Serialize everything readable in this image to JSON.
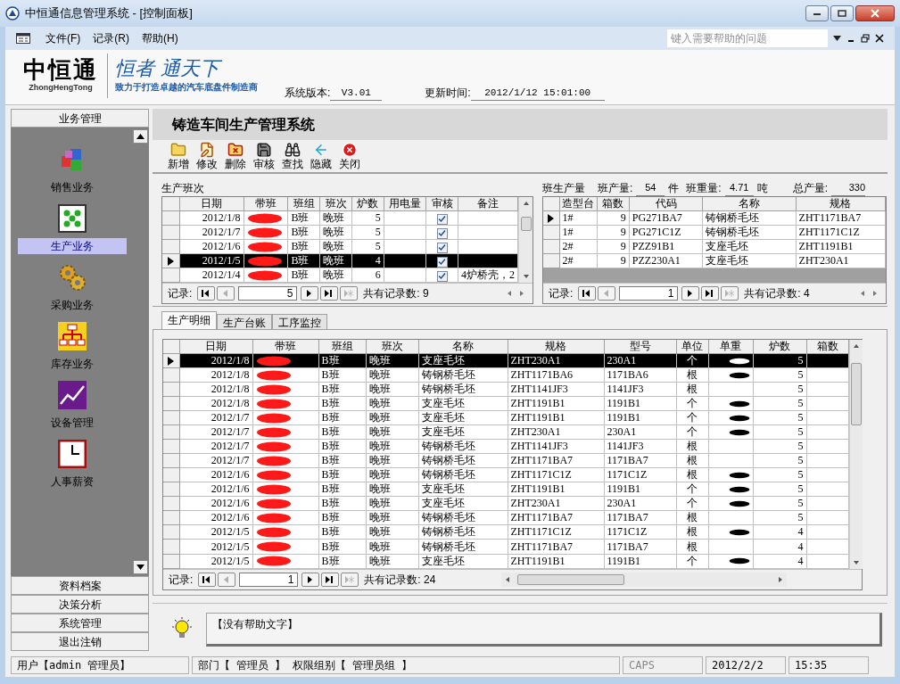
{
  "window": {
    "title": "中恒通信息管理系统 - [控制面板]"
  },
  "menu": [
    "文件(F)",
    "记录(R)",
    "帮助(H)"
  ],
  "help_search": {
    "placeholder": "键入需要帮助的问题"
  },
  "header": {
    "logo": "中恒通",
    "logo_sub": "ZhongHengTong",
    "slogan": "恒者 通天下",
    "tagline": "致力于打造卓越的汽车底盘件制造商",
    "version_label": "系统版本:",
    "version": "V3.01",
    "update_label": "更新时间:",
    "update_time": "2012/1/12 15:01:00"
  },
  "sidebar": {
    "header": "业务管理",
    "items": [
      {
        "label": "销售业务",
        "selected": false
      },
      {
        "label": "生产业务",
        "selected": true
      },
      {
        "label": "采购业务",
        "selected": false
      },
      {
        "label": "库存业务",
        "selected": false
      },
      {
        "label": "设备管理",
        "selected": false
      },
      {
        "label": "人事薪资",
        "selected": false
      }
    ],
    "buttons": [
      "资料档案",
      "决策分析",
      "系统管理",
      "退出注销"
    ]
  },
  "content": {
    "title": "铸造车间生产管理系统",
    "toolbar": [
      "新增",
      "修改",
      "删除",
      "审核",
      "查找",
      "隐藏",
      "关闭"
    ]
  },
  "shift_grid": {
    "title": "生产班次",
    "columns": [
      "日期",
      "带班",
      "班组",
      "班次",
      "炉数",
      "用电量",
      "审核",
      "备注"
    ],
    "rows": [
      {
        "date": "2012/1/8",
        "redacted": true,
        "group": "B班",
        "shift": "晚班",
        "furnaces": "5",
        "approved": true,
        "note": "",
        "current": false,
        "selected": false
      },
      {
        "date": "2012/1/7",
        "redacted": true,
        "group": "B班",
        "shift": "晚班",
        "furnaces": "5",
        "approved": true,
        "note": "",
        "current": false,
        "selected": false
      },
      {
        "date": "2012/1/6",
        "redacted": true,
        "group": "B班",
        "shift": "晚班",
        "furnaces": "5",
        "approved": true,
        "note": "",
        "current": false,
        "selected": false
      },
      {
        "date": "2012/1/5",
        "redacted": true,
        "group": "B班",
        "shift": "晚班",
        "furnaces": "4",
        "approved": true,
        "note": "",
        "current": true,
        "selected": true
      },
      {
        "date": "2012/1/4",
        "redacted": true,
        "group": "B班",
        "shift": "晚班",
        "furnaces": "6",
        "approved": true,
        "note": "4炉桥壳，2",
        "current": false,
        "selected": false
      }
    ],
    "nav": {
      "label": "记录:",
      "current": "5",
      "count": "共有记录数: 9"
    }
  },
  "output": {
    "title": "班生产量",
    "qty_label": "班产量:",
    "qty": "54",
    "qty_unit": "件",
    "weight_label": "班重量:",
    "weight": "4.71",
    "weight_unit": "吨",
    "total_label": "总产量:",
    "total": "330",
    "columns": [
      "造型台",
      "箱数",
      "代码",
      "名称",
      "规格"
    ],
    "rows": [
      {
        "cells": [
          "1#",
          "9",
          "PG271BA7",
          "铸钢桥毛坯",
          "ZHT1171BA7"
        ],
        "current": true
      },
      {
        "cells": [
          "1#",
          "9",
          "PG271C1Z",
          "铸钢桥毛坯",
          "ZHT1171C1Z"
        ],
        "current": false
      },
      {
        "cells": [
          "2#",
          "9",
          "PZZ91B1",
          "支座毛坯",
          "ZHT1191B1"
        ],
        "current": false
      },
      {
        "cells": [
          "2#",
          "9",
          "PZZ230A1",
          "支座毛坯",
          "ZHT230A1"
        ],
        "current": false
      }
    ],
    "nav": {
      "label": "记录:",
      "current": "1",
      "count": "共有记录数: 4"
    }
  },
  "tabs": [
    {
      "label": "生产明细",
      "selected": true
    },
    {
      "label": "生产台账",
      "selected": false
    },
    {
      "label": "工序监控",
      "selected": false
    }
  ],
  "detail_grid": {
    "columns": [
      "日期",
      "带班",
      "班组",
      "班次",
      "名称",
      "规格",
      "型号",
      "单位",
      "单重",
      "炉数",
      "箱数"
    ],
    "rows": [
      {
        "date": "2012/1/8",
        "group": "B班",
        "shift": "晚班",
        "name": "支座毛坯",
        "spec": "ZHT230A1",
        "model": "230A1",
        "unit": "个",
        "weight_redacted": true,
        "furnaces": "5",
        "selected": true
      },
      {
        "date": "2012/1/8",
        "group": "B班",
        "shift": "晚班",
        "name": "铸钢桥毛坯",
        "spec": "ZHT1171BA6",
        "model": "1171BA6",
        "unit": "根",
        "weight_redacted": true,
        "furnaces": "5",
        "selected": false
      },
      {
        "date": "2012/1/8",
        "group": "B班",
        "shift": "晚班",
        "name": "铸钢桥毛坯",
        "spec": "ZHT1141JF3",
        "model": "1141JF3",
        "unit": "根",
        "weight_redacted": false,
        "furnaces": "5",
        "selected": false
      },
      {
        "date": "2012/1/8",
        "group": "B班",
        "shift": "晚班",
        "name": "支座毛坯",
        "spec": "ZHT1191B1",
        "model": "1191B1",
        "unit": "个",
        "weight_redacted": true,
        "furnaces": "5",
        "selected": false
      },
      {
        "date": "2012/1/7",
        "group": "B班",
        "shift": "晚班",
        "name": "支座毛坯",
        "spec": "ZHT1191B1",
        "model": "1191B1",
        "unit": "个",
        "weight_redacted": true,
        "furnaces": "5",
        "selected": false
      },
      {
        "date": "2012/1/7",
        "group": "B班",
        "shift": "晚班",
        "name": "支座毛坯",
        "spec": "ZHT230A1",
        "model": "230A1",
        "unit": "个",
        "weight_redacted": true,
        "furnaces": "5",
        "selected": false
      },
      {
        "date": "2012/1/7",
        "group": "B班",
        "shift": "晚班",
        "name": "铸钢桥毛坯",
        "spec": "ZHT1141JF3",
        "model": "1141JF3",
        "unit": "根",
        "weight_redacted": false,
        "furnaces": "5",
        "selected": false
      },
      {
        "date": "2012/1/7",
        "group": "B班",
        "shift": "晚班",
        "name": "铸钢桥毛坯",
        "spec": "ZHT1171BA7",
        "model": "1171BA7",
        "unit": "根",
        "weight_redacted": false,
        "furnaces": "5",
        "selected": false
      },
      {
        "date": "2012/1/6",
        "group": "B班",
        "shift": "晚班",
        "name": "铸钢桥毛坯",
        "spec": "ZHT1171C1Z",
        "model": "1171C1Z",
        "unit": "根",
        "weight_redacted": true,
        "furnaces": "5",
        "selected": false
      },
      {
        "date": "2012/1/6",
        "group": "B班",
        "shift": "晚班",
        "name": "支座毛坯",
        "spec": "ZHT1191B1",
        "model": "1191B1",
        "unit": "个",
        "weight_redacted": true,
        "furnaces": "5",
        "selected": false
      },
      {
        "date": "2012/1/6",
        "group": "B班",
        "shift": "晚班",
        "name": "支座毛坯",
        "spec": "ZHT230A1",
        "model": "230A1",
        "unit": "个",
        "weight_redacted": true,
        "furnaces": "5",
        "selected": false
      },
      {
        "date": "2012/1/6",
        "group": "B班",
        "shift": "晚班",
        "name": "铸钢桥毛坯",
        "spec": "ZHT1171BA7",
        "model": "1171BA7",
        "unit": "根",
        "weight_redacted": false,
        "furnaces": "5",
        "selected": false
      },
      {
        "date": "2012/1/5",
        "group": "B班",
        "shift": "晚班",
        "name": "铸钢桥毛坯",
        "spec": "ZHT1171C1Z",
        "model": "1171C1Z",
        "unit": "根",
        "weight_redacted": true,
        "furnaces": "4",
        "selected": false
      },
      {
        "date": "2012/1/5",
        "group": "B班",
        "shift": "晚班",
        "name": "铸钢桥毛坯",
        "spec": "ZHT1171BA7",
        "model": "1171BA7",
        "unit": "根",
        "weight_redacted": false,
        "furnaces": "4",
        "selected": false
      },
      {
        "date": "2012/1/5",
        "group": "B班",
        "shift": "晚班",
        "name": "支座毛坯",
        "spec": "ZHT1191B1",
        "model": "1191B1",
        "unit": "个",
        "weight_redacted": true,
        "furnaces": "4",
        "selected": false
      }
    ],
    "nav": {
      "label": "记录:",
      "current": "1",
      "count": "共有记录数: 24"
    }
  },
  "help_text": "【没有帮助文字】",
  "status_bar": [
    "用户【admin 管理员】",
    "部门【 管理员 】 权限组别【 管理员组 】",
    "CAPS",
    "2012/2/2",
    "15:35"
  ]
}
